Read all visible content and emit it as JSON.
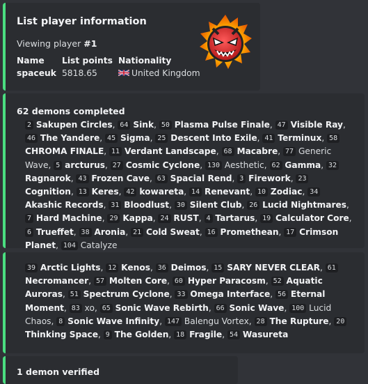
{
  "player_card": {
    "title": "List player information",
    "viewing_prefix": "Viewing player ",
    "player_rank": "#1",
    "fields": [
      {
        "name": "Name",
        "value": "spaceuk"
      },
      {
        "name": "List points",
        "value": "5818.65"
      },
      {
        "name": "Nationality",
        "value": "United Kingdom",
        "flag": "uk-flag-icon"
      }
    ],
    "thumbnail_icon": "extreme-demon-face-icon",
    "accent_color": "#4ade80"
  },
  "completed_card": {
    "title": "62 demons completed",
    "demons": [
      {
        "rank": "2",
        "name": "Sakupen Circles",
        "bold": true
      },
      {
        "rank": "64",
        "name": "Sink",
        "bold": true
      },
      {
        "rank": "50",
        "name": "Plasma Pulse Finale",
        "bold": true
      },
      {
        "rank": "47",
        "name": "Visible Ray",
        "bold": true
      },
      {
        "rank": "46",
        "name": "The Yandere",
        "bold": true
      },
      {
        "rank": "45",
        "name": "Sigma",
        "bold": true
      },
      {
        "rank": "25",
        "name": "Descent Into Exile",
        "bold": true
      },
      {
        "rank": "41",
        "name": "Terminux",
        "bold": true
      },
      {
        "rank": "58",
        "name": "CHROMA FINALE",
        "bold": true
      },
      {
        "rank": "11",
        "name": "Verdant Landscape",
        "bold": true
      },
      {
        "rank": "68",
        "name": "Macabre",
        "bold": true
      },
      {
        "rank": "77",
        "name": "Generic Wave",
        "bold": false
      },
      {
        "rank": "5",
        "name": "arcturus",
        "bold": true
      },
      {
        "rank": "27",
        "name": "Cosmic Cyclone",
        "bold": true
      },
      {
        "rank": "130",
        "name": "Aesthetic",
        "bold": false
      },
      {
        "rank": "62",
        "name": "Gamma",
        "bold": true
      },
      {
        "rank": "32",
        "name": "Ragnarok",
        "bold": true
      },
      {
        "rank": "43",
        "name": "Frozen Cave",
        "bold": true
      },
      {
        "rank": "63",
        "name": "Spacial Rend",
        "bold": true
      },
      {
        "rank": "3",
        "name": "Firework",
        "bold": true
      },
      {
        "rank": "23",
        "name": "Cognition",
        "bold": true
      },
      {
        "rank": "13",
        "name": "Keres",
        "bold": true
      },
      {
        "rank": "42",
        "name": "kowareta",
        "bold": true
      },
      {
        "rank": "14",
        "name": "Renevant",
        "bold": true
      },
      {
        "rank": "10",
        "name": "Zodiac",
        "bold": true
      },
      {
        "rank": "34",
        "name": "Akashic Records",
        "bold": true
      },
      {
        "rank": "31",
        "name": "Bloodlust",
        "bold": true
      },
      {
        "rank": "30",
        "name": "Silent Club",
        "bold": true
      },
      {
        "rank": "26",
        "name": "Lucid Nightmares",
        "bold": true
      },
      {
        "rank": "7",
        "name": "Hard Machine",
        "bold": true
      },
      {
        "rank": "29",
        "name": "Kappa",
        "bold": true
      },
      {
        "rank": "24",
        "name": "RUST",
        "bold": true
      },
      {
        "rank": "4",
        "name": "Tartarus",
        "bold": true
      },
      {
        "rank": "19",
        "name": "Calculator Core",
        "bold": true
      },
      {
        "rank": "6",
        "name": "Trueffet",
        "bold": true
      },
      {
        "rank": "38",
        "name": "Aronia",
        "bold": true
      },
      {
        "rank": "21",
        "name": "Cold Sweat",
        "bold": true
      },
      {
        "rank": "16",
        "name": "Promethean",
        "bold": true
      },
      {
        "rank": "17",
        "name": "Crimson Planet",
        "bold": true
      },
      {
        "rank": "104",
        "name": "Catalyze",
        "bold": false
      }
    ]
  },
  "completed_card_cont": {
    "demons": [
      {
        "rank": "39",
        "name": "Arctic Lights",
        "bold": true
      },
      {
        "rank": "12",
        "name": "Kenos",
        "bold": true
      },
      {
        "rank": "36",
        "name": "Deimos",
        "bold": true
      },
      {
        "rank": "15",
        "name": "SARY NEVER CLEAR",
        "bold": true
      },
      {
        "rank": "61",
        "name": "Necromancer",
        "bold": true
      },
      {
        "rank": "57",
        "name": "Molten Core",
        "bold": true
      },
      {
        "rank": "60",
        "name": "Hyper Paracosm",
        "bold": true
      },
      {
        "rank": "52",
        "name": "Aquatic Auroras",
        "bold": true
      },
      {
        "rank": "51",
        "name": "Spectrum Cyclone",
        "bold": true
      },
      {
        "rank": "33",
        "name": "Omega Interface",
        "bold": true
      },
      {
        "rank": "56",
        "name": "Eternal Moment",
        "bold": true
      },
      {
        "rank": "83",
        "name": "xo",
        "bold": false
      },
      {
        "rank": "65",
        "name": "Sonic Wave Rebirth",
        "bold": true
      },
      {
        "rank": "66",
        "name": "Sonic Wave",
        "bold": true
      },
      {
        "rank": "100",
        "name": "Lucid Chaos",
        "bold": false
      },
      {
        "rank": "8",
        "name": "Sonic Wave Infinity",
        "bold": true
      },
      {
        "rank": "147",
        "name": "Balengu Vortex",
        "bold": false
      },
      {
        "rank": "28",
        "name": "The Rupture",
        "bold": true
      },
      {
        "rank": "20",
        "name": "Thinking Space",
        "bold": true
      },
      {
        "rank": "9",
        "name": "The Golden",
        "bold": true
      },
      {
        "rank": "18",
        "name": "Fragile",
        "bold": true
      },
      {
        "rank": "54",
        "name": "Wasureta",
        "bold": true
      }
    ]
  },
  "next_card": {
    "title": "1 demon verified"
  }
}
